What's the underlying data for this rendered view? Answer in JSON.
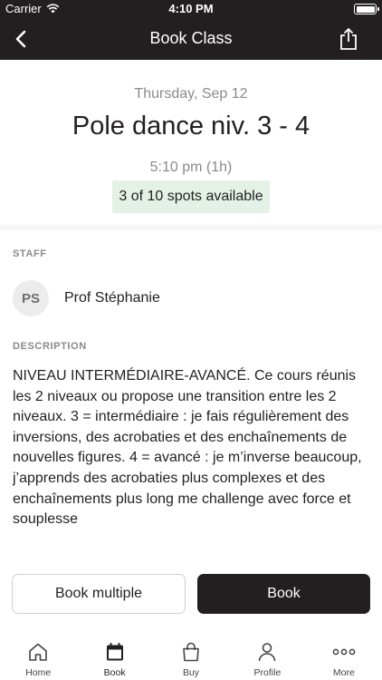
{
  "status_bar": {
    "carrier": "Carrier",
    "time": "4:10 PM"
  },
  "nav": {
    "title": "Book Class",
    "back_icon": "chevron-left-icon",
    "share_icon": "share-icon"
  },
  "class_info": {
    "date": "Thursday, Sep 12",
    "name": "Pole dance niv. 3 - 4",
    "time": "5:10 pm (1h)",
    "spots": "3 of 10 spots available",
    "spots_color": "#e3f1e6"
  },
  "staff": {
    "label": "STAFF",
    "initials": "PS",
    "name": "Prof Stéphanie"
  },
  "description": {
    "label": "DESCRIPTION",
    "text": "NIVEAU INTERMÉDIAIRE-AVANCÉ. Ce cours réunis les 2 niveaux ou propose une transition entre les 2 niveaux. 3 = intermédiaire : je fais régulièrement des inversions, des acrobaties et des enchaînements de nouvelles figures. 4 = avancé : je m’inverse beaucoup, j’apprends des acrobaties plus complexes et des enchaînements plus long me challenge avec force et souplesse"
  },
  "actions": {
    "book_multiple": "Book multiple",
    "book": "Book"
  },
  "tabs": [
    {
      "label": "Home",
      "icon": "home-icon"
    },
    {
      "label": "Book",
      "icon": "calendar-icon",
      "active": true
    },
    {
      "label": "Buy",
      "icon": "shopping-bag-icon"
    },
    {
      "label": "Profile",
      "icon": "profile-icon"
    },
    {
      "label": "More",
      "icon": "more-dots-icon"
    }
  ],
  "colors": {
    "brand_dark": "#231f20",
    "muted_text": "#8a8a8a"
  }
}
